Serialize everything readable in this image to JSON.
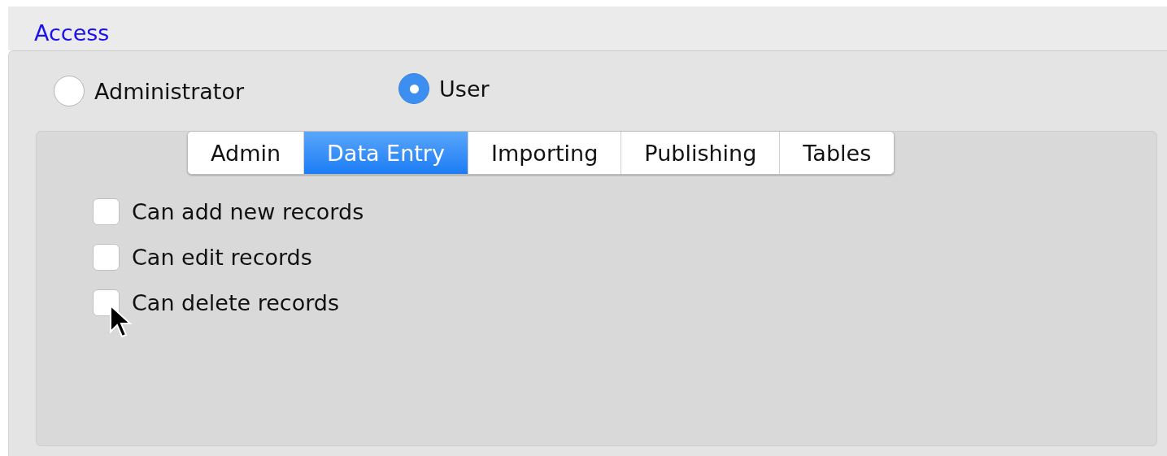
{
  "section": {
    "title": "Access"
  },
  "roles": [
    {
      "label": "Administrator",
      "selected": false
    },
    {
      "label": "User",
      "selected": true
    }
  ],
  "tabs": [
    {
      "label": "Admin",
      "selected": false
    },
    {
      "label": "Data Entry",
      "selected": true
    },
    {
      "label": "Importing",
      "selected": false
    },
    {
      "label": "Publishing",
      "selected": false
    },
    {
      "label": "Tables",
      "selected": false
    }
  ],
  "permissions": [
    {
      "label": "Can add new records",
      "checked": false
    },
    {
      "label": "Can edit records",
      "checked": false
    },
    {
      "label": "Can delete records",
      "checked": false
    }
  ]
}
